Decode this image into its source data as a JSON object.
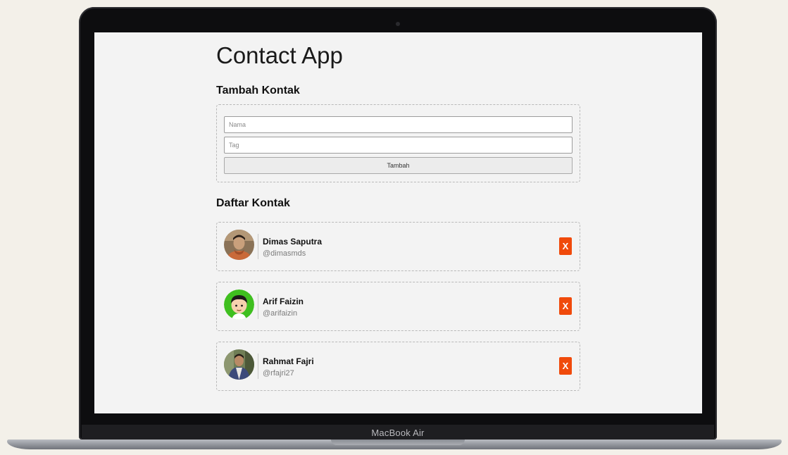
{
  "device": {
    "label": "MacBook Air"
  },
  "app": {
    "title": "Contact App",
    "form": {
      "heading": "Tambah Kontak",
      "name_placeholder": "Nama",
      "name_value": "",
      "tag_placeholder": "Tag",
      "tag_value": "",
      "submit_label": "Tambah"
    },
    "list": {
      "heading": "Daftar Kontak",
      "contacts": [
        {
          "name": "Dimas Saputra",
          "tag": "@dimasmds",
          "avatar": "photo-avatar",
          "delete_label": "X"
        },
        {
          "name": "Arif Faizin",
          "tag": "@arifaizin",
          "avatar": "cartoon-avatar",
          "delete_label": "X"
        },
        {
          "name": "Rahmat Fajri",
          "tag": "@rfajri27",
          "avatar": "photo-avatar",
          "delete_label": "X"
        }
      ]
    }
  },
  "colors": {
    "delete_accent": "#f04a0b",
    "screen_background": "#f3f3f3",
    "page_background": "#f3f0e9"
  }
}
